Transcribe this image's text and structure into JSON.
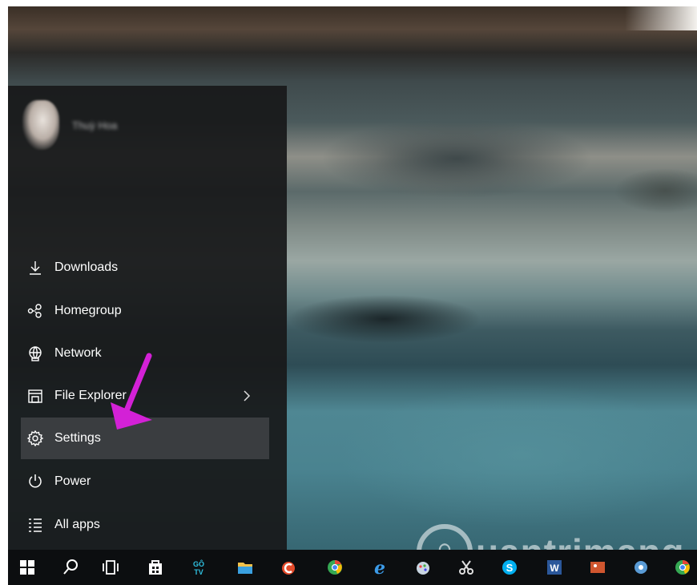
{
  "start_menu": {
    "user_name": "Thuỳ Hoa",
    "items": [
      {
        "label": "Downloads",
        "icon": "download-icon"
      },
      {
        "label": "Homegroup",
        "icon": "homegroup-icon"
      },
      {
        "label": "Network",
        "icon": "network-icon"
      },
      {
        "label": "File Explorer",
        "icon": "file-explorer-icon",
        "has_submenu": true
      },
      {
        "label": "Settings",
        "icon": "gear-icon",
        "selected": true
      },
      {
        "label": "Power",
        "icon": "power-icon"
      },
      {
        "label": "All apps",
        "icon": "all-apps-icon"
      }
    ]
  },
  "annotation": {
    "arrow_color": "#d321d6"
  },
  "watermark": {
    "text": "uantrimang"
  },
  "taskbar": {
    "items": [
      "windows-start-icon",
      "search-icon",
      "task-view-icon",
      "store-icon",
      "gotv-icon",
      "explorer-icon",
      "ccleaner-icon",
      "chrome-icon",
      "edge-icon",
      "paint-icon",
      "snipping-icon",
      "skype-icon",
      "word-icon",
      "photos-icon",
      "app-icon",
      "chrome-icon"
    ],
    "gotv_label": "GÔ TV"
  },
  "colors": {
    "accent": "#1e90ff",
    "menu_bg": "#181a1b",
    "selected_bg": "#3a3d40",
    "taskbar_bg": "#0c0e10"
  }
}
